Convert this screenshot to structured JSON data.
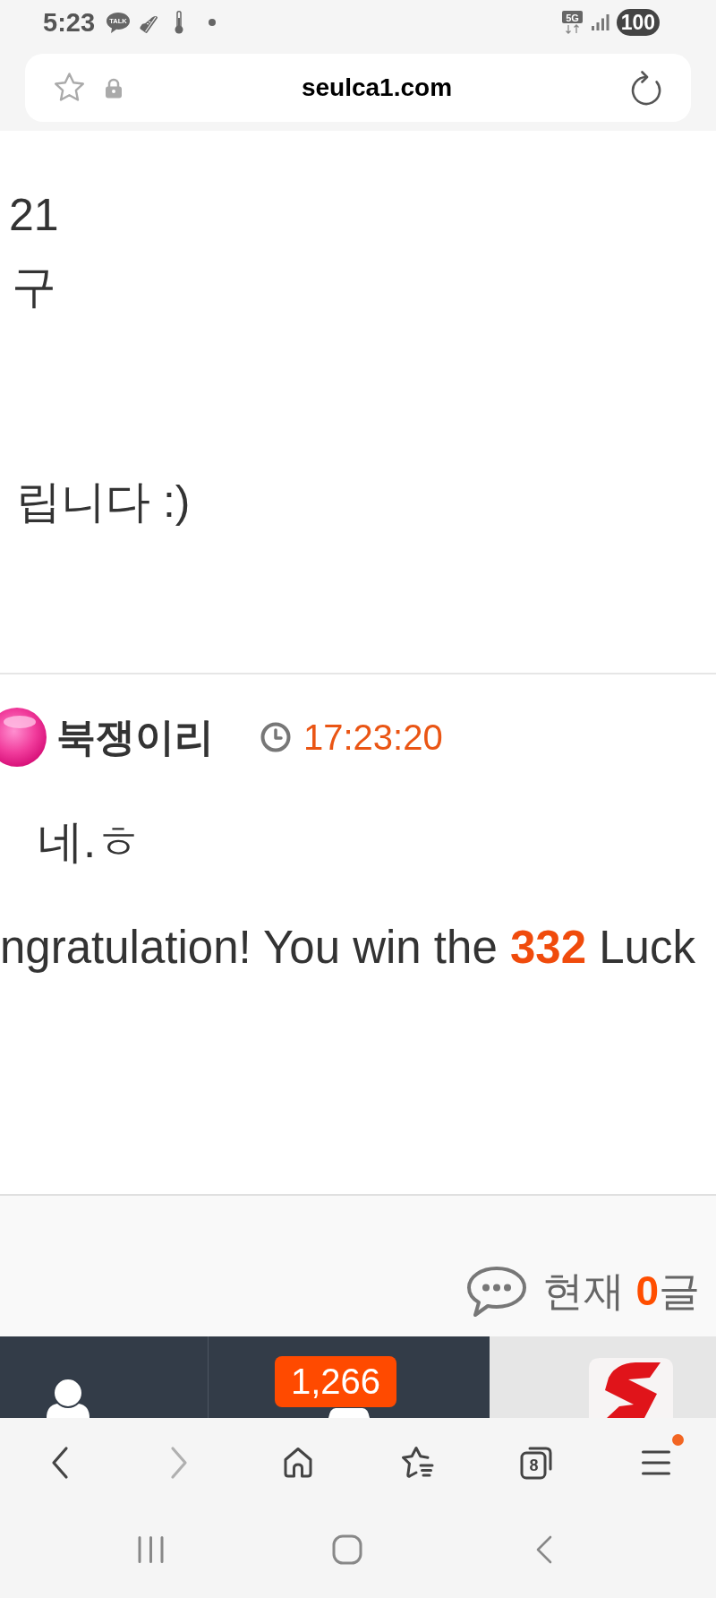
{
  "status_bar": {
    "time": "5:23",
    "chat_label": "TALK",
    "network": "5G",
    "battery": "100"
  },
  "address_bar": {
    "url": "seulca1.com"
  },
  "post": {
    "paragraphs": [
      {
        "lines": [
          "21",
          "구"
        ]
      },
      {
        "lines": [
          "립니다 :)"
        ]
      }
    ]
  },
  "comment": {
    "author": "북쟁이리",
    "time": "17:23:20",
    "paragraphs": [
      "네.ㅎ",
      "ngratulation! You win the **332** Luck"
    ]
  },
  "comment_count": {
    "text": "현재 **0**글"
  },
  "bottom_nav": {
    "badge": "1,266"
  },
  "browser_toolbar": {
    "buttons": [
      {
        "kind": "back",
        "disabled": false,
        "notification": false
      },
      {
        "kind": "forward",
        "disabled": true,
        "notification": false
      },
      {
        "kind": "home",
        "disabled": false,
        "notification": false
      },
      {
        "kind": "bookmarks",
        "disabled": false,
        "notification": false
      },
      {
        "kind": "tabs",
        "label": "8",
        "disabled": false,
        "notification": false
      },
      {
        "kind": "menu",
        "disabled": false,
        "notification": true
      }
    ]
  }
}
